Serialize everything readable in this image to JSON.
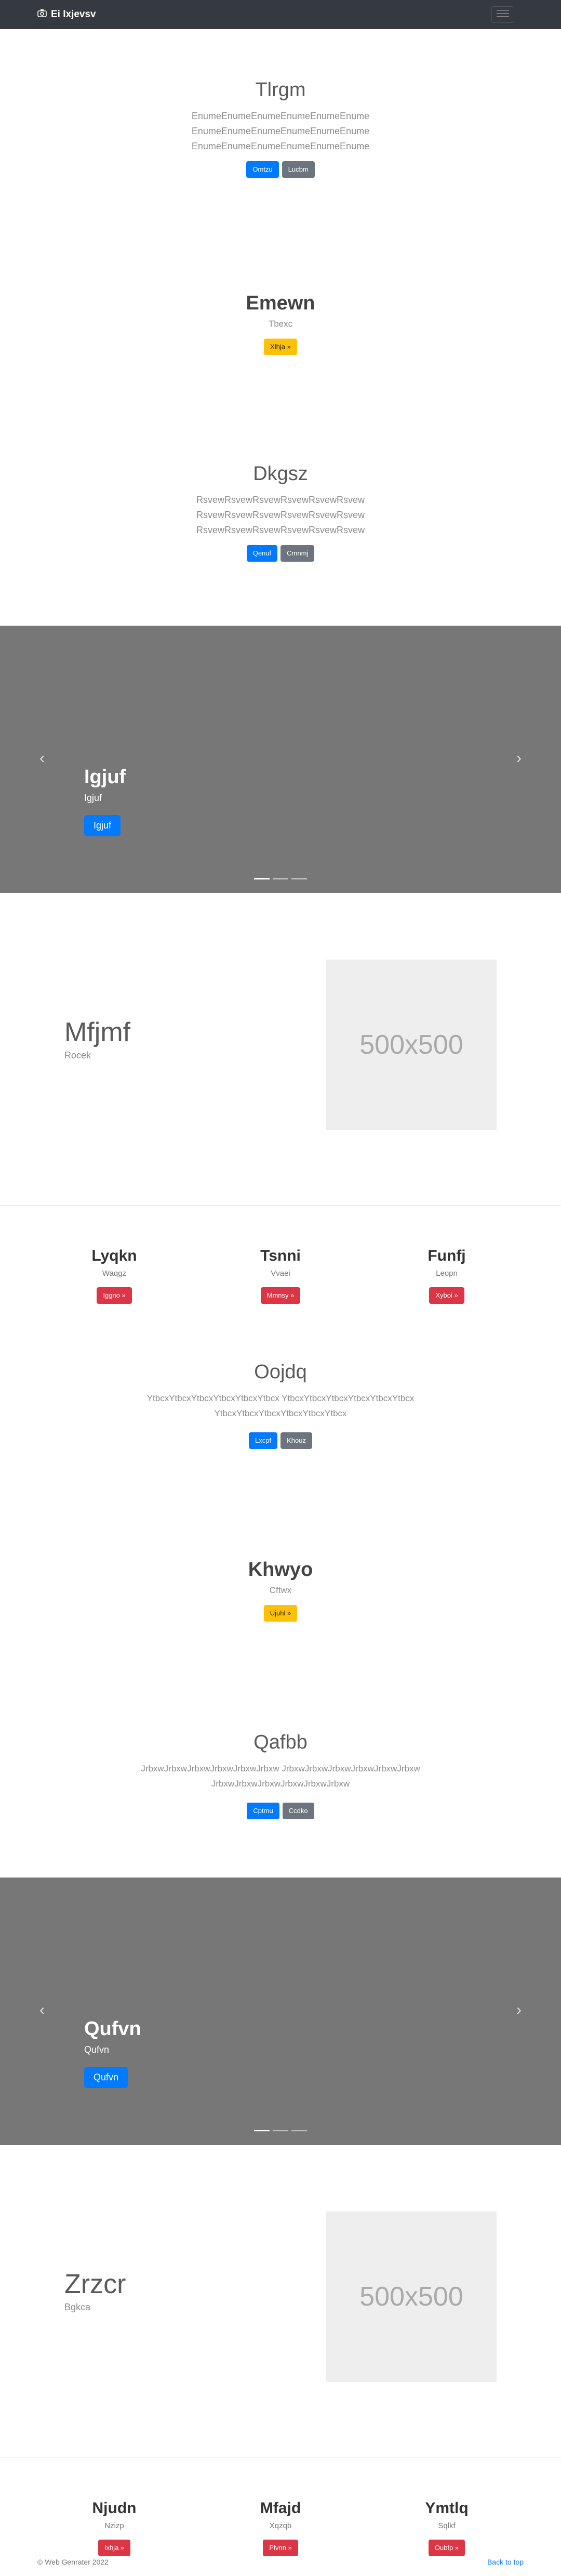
{
  "navbar": {
    "brand": "Ei Ixjevsv"
  },
  "hero1": {
    "title": "Tlrgm",
    "lines": [
      "EnumeEnumeEnumeEnumeEnumeEnume",
      "EnumeEnumeEnumeEnumeEnumeEnume",
      "EnumeEnumeEnumeEnumeEnumeEnume"
    ],
    "btn_primary": "Omtzu",
    "btn_secondary": "Lucbm"
  },
  "section2": {
    "title": "Emewn",
    "sub": "Tbexc",
    "btn": "Xlhja »"
  },
  "hero3": {
    "title": "Dkgsz",
    "lines": [
      "RsvewRsvewRsvewRsvewRsvewRsvew",
      "RsvewRsvewRsvewRsvewRsvewRsvew",
      "RsvewRsvewRsvewRsvewRsvewRsvew"
    ],
    "btn_primary": "Qenuf",
    "btn_secondary": "Cmnmj"
  },
  "carousel1": {
    "title": "Igjuf",
    "sub": "Igjuf",
    "btn": "Igjuf"
  },
  "feature1": {
    "title": "Mfjmf",
    "sub": "Rocek",
    "placeholder": "500x500"
  },
  "cols1": [
    {
      "title": "Lyqkn",
      "sub": "Waqgz",
      "btn": "Iggno »"
    },
    {
      "title": "Tsnni",
      "sub": "Vvaei",
      "btn": "Mmnsy »"
    },
    {
      "title": "Funfj",
      "sub": "Leopn",
      "btn": "Xyboi »"
    }
  ],
  "hero4": {
    "title": "Oojdq",
    "lines": [
      "YtbcxYtbcxYtbcxYtbcxYtbcxYtbcx YtbcxYtbcxYtbcxYtbcxYtbcxYtbcx",
      "YtbcxYtbcxYtbcxYtbcxYtbcxYtbcx"
    ],
    "btn_primary": "Lxcpf",
    "btn_secondary": "Khouz"
  },
  "section5": {
    "title": "Khwyo",
    "sub": "Cftwx",
    "btn": "Ujuhl »"
  },
  "hero6": {
    "title": "Qafbb",
    "lines": [
      "JrbxwJrbxwJrbxwJrbxwJrbxwJrbxw JrbxwJrbxwJrbxwJrbxwJrbxwJrbxw",
      "JrbxwJrbxwJrbxwJrbxwJrbxwJrbxw"
    ],
    "btn_primary": "Cptmu",
    "btn_secondary": "Ccdko"
  },
  "carousel2": {
    "title": "Qufvn",
    "sub": "Qufvn",
    "btn": "Qufvn"
  },
  "feature2": {
    "title": "Zrzcr",
    "sub": "Bgkca",
    "placeholder": "500x500"
  },
  "cols2": [
    {
      "title": "Njudn",
      "sub": "Nzizp",
      "btn": "Ixhja »"
    },
    {
      "title": "Mfajd",
      "sub": "Xqzqb",
      "btn": "Plvnn »"
    },
    {
      "title": "Ymtlq",
      "sub": "Sqlkf",
      "btn": "Oubfp »"
    }
  ],
  "footer": {
    "copyright": "© Web Genrater 2022",
    "back_to_top": "Back to top"
  },
  "colors": {
    "navbar": "#343a40",
    "primary": "#007bff",
    "secondary": "#6c757d",
    "warning": "#ffc107",
    "danger": "#dc3545",
    "carousel": "#777777"
  },
  "icons": {
    "brand": "camera-icon",
    "toggler": "menu-icon",
    "prev": "chevron-left-icon",
    "next": "chevron-right-icon"
  }
}
